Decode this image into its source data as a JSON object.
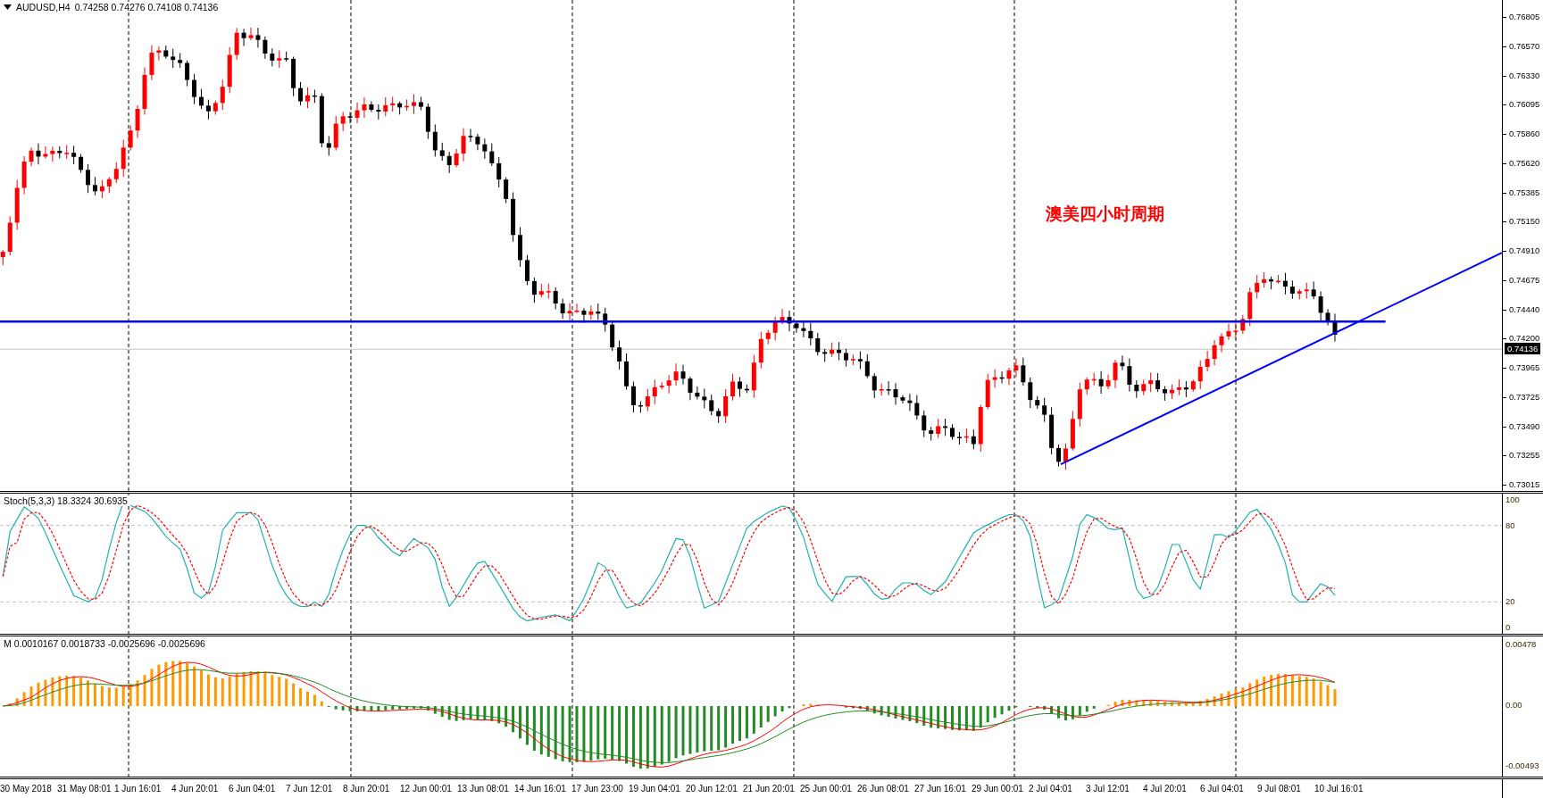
{
  "header": {
    "symbol": "AUDUSD,H4",
    "quotes": "0.74258 0.74276 0.74108 0.74136"
  },
  "price_axis": {
    "labels": [
      "0.76805",
      "0.76570",
      "0.76330",
      "0.76095",
      "0.75860",
      "0.75620",
      "0.75385",
      "0.75150",
      "0.74910",
      "0.74675",
      "0.74440",
      "0.74200",
      "0.73965",
      "0.73725",
      "0.73490",
      "0.73255",
      "0.73015"
    ],
    "current_price": "0.74136"
  },
  "annotation": "澳美四小时周期",
  "stochastic": {
    "title": "Stoch(5,3,3) 18.3324 30.6935",
    "axis_labels": [
      "100",
      "80",
      "20",
      "0"
    ]
  },
  "macd": {
    "title": "M 0.0010167 0.0018733 -0.0025696 -0.0025696",
    "axis_labels": [
      "0.00478",
      "0.00",
      "-0.00493"
    ]
  },
  "time_axis": [
    "30 May 2018",
    "31 May 08:01",
    "1 Jun 16:01",
    "4 Jun 20:01",
    "6 Jun 04:01",
    "7 Jun 12:01",
    "8 Jun 20:01",
    "12 Jun 00:01",
    "13 Jun 08:01",
    "14 Jun 16:01",
    "17 Jun 23:00",
    "19 Jun 04:01",
    "20 Jun 12:01",
    "21 Jun 20:01",
    "25 Jun 00:01",
    "26 Jun 08:01",
    "27 Jun 16:01",
    "29 Jun 00:01",
    "2 Jul 04:01",
    "3 Jul 12:01",
    "4 Jul 20:01",
    "6 Jul 04:01",
    "9 Jul 08:01",
    "10 Jul 16:01"
  ]
}
